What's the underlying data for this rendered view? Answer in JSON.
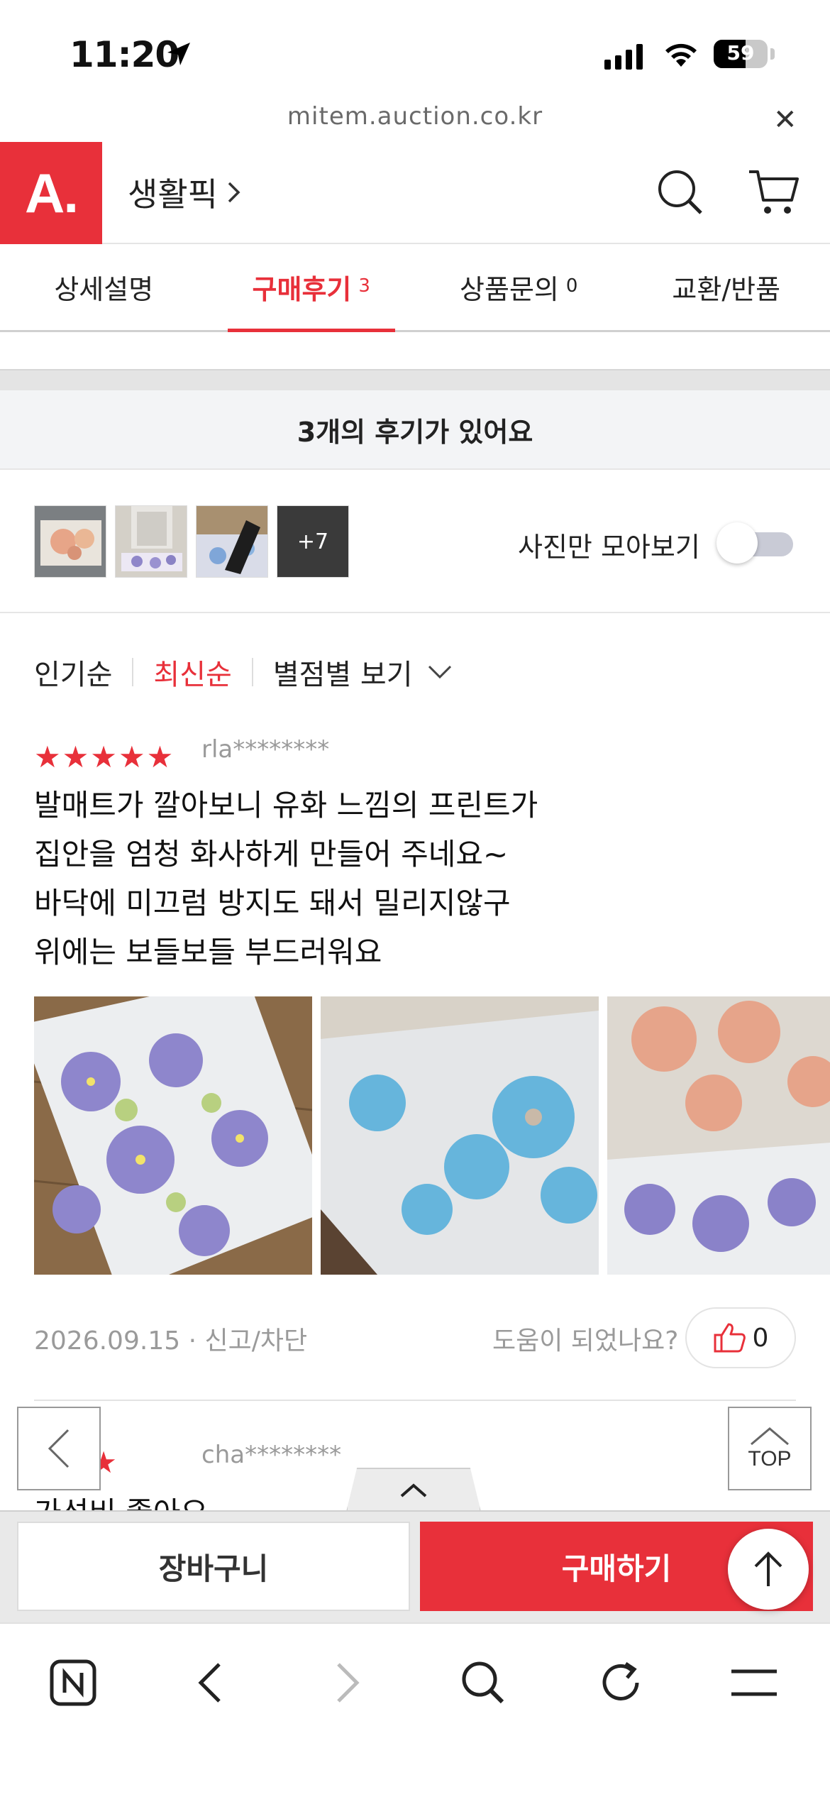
{
  "status_bar": {
    "time": "11:20",
    "battery": "59",
    "battery_level": 0.59
  },
  "browser": {
    "url": "mitem.auction.co.kr",
    "close_icon": "close-icon"
  },
  "header": {
    "logo": "A.",
    "category": "생활픽",
    "icons": [
      "search-icon",
      "cart-icon"
    ]
  },
  "tabs": [
    {
      "label": "상세설명",
      "count": ""
    },
    {
      "label": "구매후기",
      "count": "3"
    },
    {
      "label": "상품문의",
      "count": "0"
    },
    {
      "label": "교환/반품",
      "count": ""
    }
  ],
  "summary": "3개의 후기가 있어요",
  "photo_strip": {
    "more_label": "+7",
    "toggle_label": "사진만 모아보기",
    "toggle_on": false
  },
  "sort": {
    "popular": "인기순",
    "latest": "최신순",
    "rating": "별점별 보기"
  },
  "reviews": [
    {
      "stars": "★★★★★",
      "rating": 5,
      "user": "rla********",
      "lines": [
        "발매트가 깔아보니 유화 느낌의 프린트가",
        "집안을 엄청 화사하게 만들어 주네요~",
        "바닥에 미끄럼 방지도 돼서 밀리지않구",
        "위에는 보들보들 부드러워요"
      ],
      "date": "2026.09.15",
      "report": "신고/차단",
      "helpful_q": "도움이 되었나요?",
      "likes": "0"
    },
    {
      "stars": "★★★",
      "user": "cha********",
      "first_line": "가성비 좋아요"
    }
  ],
  "floating": {
    "top_label": "TOP"
  },
  "buy_bar": {
    "cart": "장바구니",
    "buy": "구매하기"
  },
  "colors": {
    "accent": "#e8303a",
    "gray_text": "#9a9a9a"
  }
}
